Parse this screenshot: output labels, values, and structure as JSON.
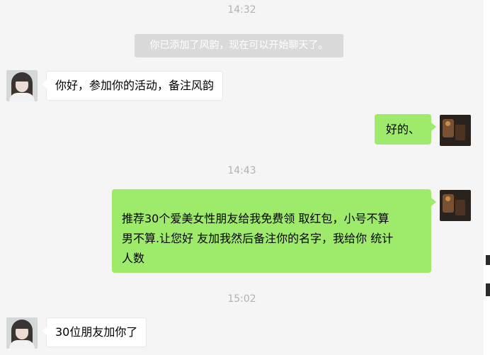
{
  "chat": {
    "timestamps": [
      "14:32",
      "14:43",
      "15:02"
    ],
    "system_notice": "你已添加了风韵，现在可以开始聊天了。",
    "messages": [
      {
        "side": "left",
        "lines": [
          "你好，参加你的活动，备注风韵"
        ]
      },
      {
        "side": "right",
        "lines": [
          "好的、"
        ]
      },
      {
        "side": "right",
        "lines": [
          "推荐30个爱美女性朋友给我免费领 取红包，小号不算",
          "男不算.让您好 友加我然后备注你的名字，我给你 统计",
          "人数"
        ]
      },
      {
        "side": "left",
        "lines": [
          "30位朋友加你了"
        ]
      }
    ]
  },
  "colors": {
    "background": "#f5f5f5",
    "incoming_bubble": "#ffffff",
    "outgoing_bubble": "#9eea6a",
    "timestamp_text": "#b2b2b2",
    "system_notice_bg": "#dadada"
  },
  "icons": {
    "contact_avatar": "contact-avatar-photo",
    "my_avatar": "my-avatar-photo"
  }
}
